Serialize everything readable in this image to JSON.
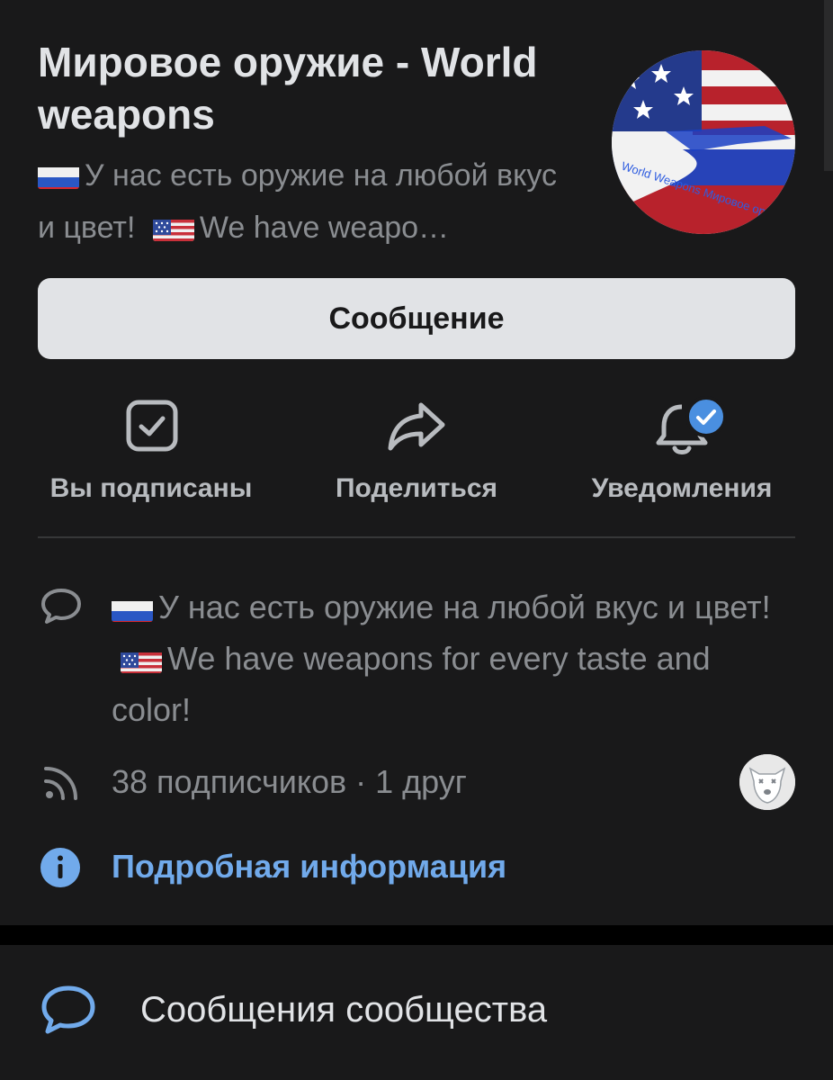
{
  "community": {
    "name": "Мировое оружие - World weapons",
    "status_ru": "У нас есть оружие на любой вкус и цвет!",
    "status_en": "We have weapo…",
    "avatar_text": "World Weapons Мировое оружие"
  },
  "buttons": {
    "message": "Сообщение"
  },
  "actions": {
    "subscribed": "Вы подписаны",
    "share": "Поделиться",
    "notifications": "Уведомления"
  },
  "description": {
    "ru": "У нас есть оружие на любой вкус и цвет!",
    "en": "We have weapons for every taste and color!"
  },
  "stats": {
    "followers": "38 подписчиков · 1 друг"
  },
  "links": {
    "details": "Подробная информация",
    "community_messages": "Сообщения сообщества"
  },
  "colors": {
    "background": "#19191a",
    "primary_text": "#e1e3e6",
    "secondary_text": "#8a8d91",
    "accent": "#71aaeb",
    "button_bg": "#e1e3e6",
    "badge": "#4a8fe0"
  },
  "icons": [
    "checkbox-checked-icon",
    "share-arrow-icon",
    "bell-icon",
    "check-badge-icon",
    "comment-icon",
    "rss-icon",
    "info-icon",
    "chat-bubble-icon",
    "russia-flag-icon",
    "usa-flag-icon"
  ]
}
